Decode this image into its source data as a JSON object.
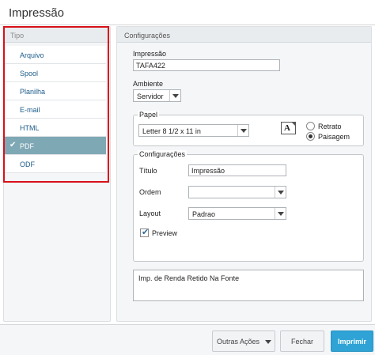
{
  "window": {
    "title": "Impressão"
  },
  "tipo": {
    "header": "Tipo",
    "items": [
      {
        "label": "Arquivo",
        "selected": false
      },
      {
        "label": "Spool",
        "selected": false
      },
      {
        "label": "Planilha",
        "selected": false
      },
      {
        "label": "E-mail",
        "selected": false
      },
      {
        "label": "HTML",
        "selected": false
      },
      {
        "label": "PDF",
        "selected": true
      },
      {
        "label": "ODF",
        "selected": false
      }
    ]
  },
  "config": {
    "header": "Configurações",
    "impressao_label": "Impressão",
    "impressao_value": "TAFA422",
    "ambiente_label": "Ambiente",
    "ambiente_value": "Servidor",
    "papel": {
      "legend": "Papel",
      "value": "Letter 8 1/2 x 11 in",
      "retrato_label": "Retrato",
      "paisagem_label": "Paisagem",
      "orientation_selected": "Paisagem",
      "orientation_icon_glyph": "A"
    },
    "configuracoes": {
      "legend": "Configurações",
      "titulo_label": "Título",
      "titulo_value": "Impressão",
      "ordem_label": "Ordem",
      "ordem_value": "",
      "layout_label": "Layout",
      "layout_value": "Padrao",
      "preview_label": "Preview",
      "preview_checked": true
    },
    "description": "Imp. de Renda Retido Na Fonte"
  },
  "footer": {
    "outras_acoes": "Outras Ações",
    "fechar": "Fechar",
    "imprimir": "Imprimir"
  },
  "colors": {
    "selected_item_bg": "#7fa8b5",
    "primary_button": "#2fa3d6",
    "highlight_frame": "#d9111a",
    "link_text": "#1d5c8a"
  }
}
